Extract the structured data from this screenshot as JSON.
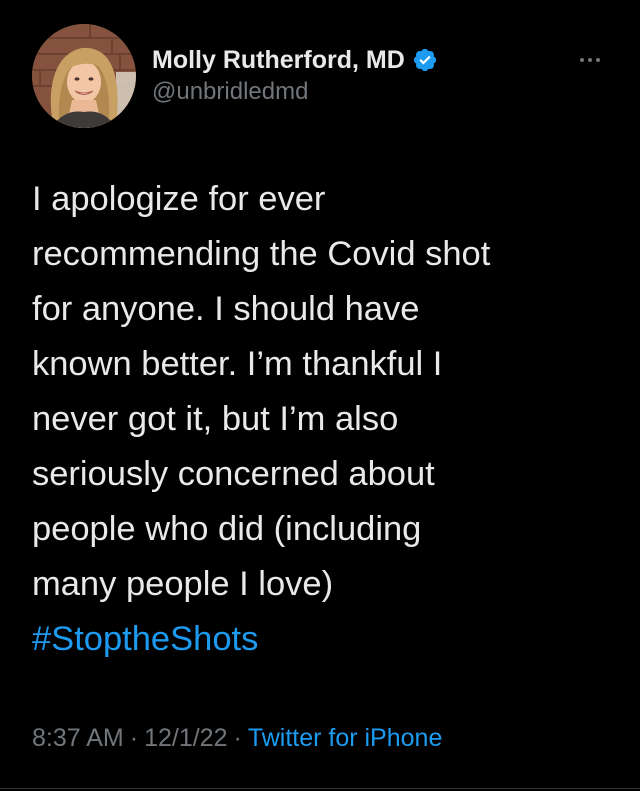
{
  "author": {
    "display_name": "Molly Rutherford, MD",
    "handle": "@unbridledmd",
    "verified": true,
    "avatar_icon": "profile-photo",
    "verified_icon": "verified-badge-icon"
  },
  "menu_icon": "more-horizontal-icon",
  "tweet": {
    "lines": [
      "I apologize for ever",
      "recommending the Covid shot",
      "for anyone. I should have",
      "known better. I’m thankful I",
      "never got it, but I’m also",
      "seriously concerned about",
      "people who did (including",
      "many people I love)"
    ],
    "hashtag": "#StoptheShots"
  },
  "meta": {
    "time": "8:37 AM",
    "separator": "·",
    "date": "12/1/22",
    "source": "Twitter for iPhone"
  },
  "colors": {
    "background": "#000000",
    "text": "#e7e9ea",
    "secondary_text": "#71767b",
    "accent": "#1d9bf0"
  }
}
